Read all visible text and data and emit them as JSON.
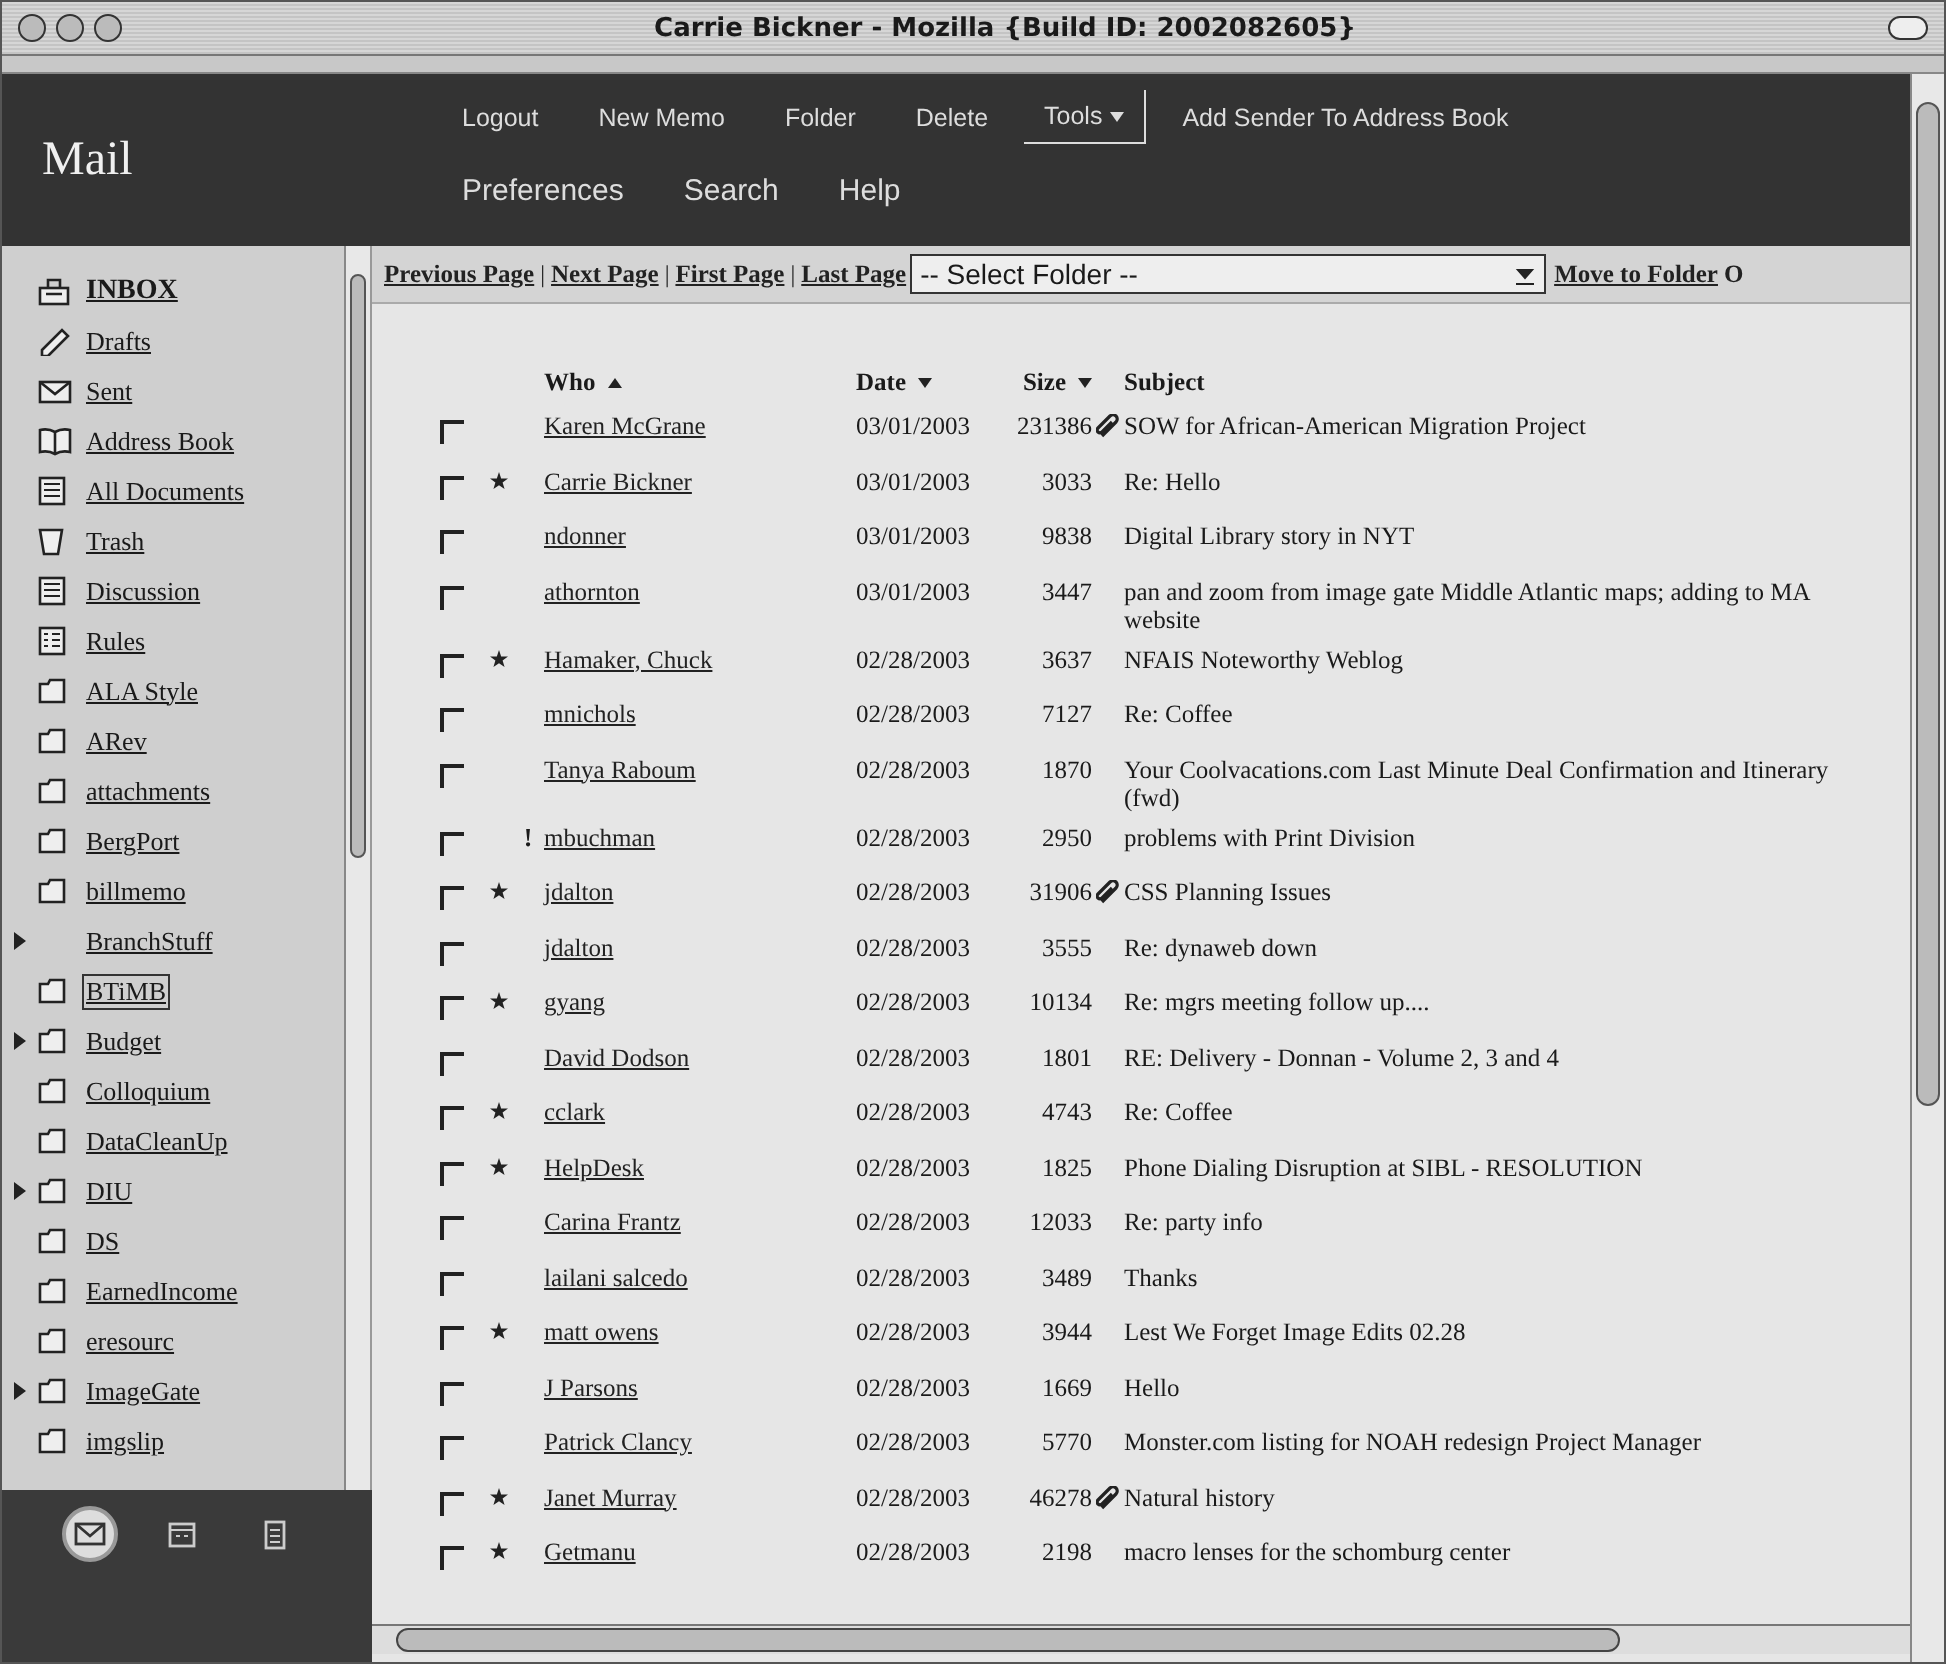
{
  "window": {
    "title": "Carrie Bickner - Mozilla {Build ID: 2002082605}"
  },
  "header": {
    "app_name": "Mail",
    "nav_rows": [
      [
        {
          "label": "Logout",
          "kind": "link"
        },
        {
          "label": "New Memo",
          "kind": "link"
        },
        {
          "label": "Folder",
          "kind": "link"
        },
        {
          "label": "Delete",
          "kind": "link"
        },
        {
          "label": "Tools",
          "kind": "menu"
        },
        {
          "label": "Add Sender To Address Book",
          "kind": "link"
        }
      ],
      [
        {
          "label": "Preferences",
          "kind": "link"
        },
        {
          "label": "Search",
          "kind": "link"
        },
        {
          "label": "Help",
          "kind": "link"
        }
      ]
    ]
  },
  "sidebar": {
    "items": [
      {
        "label": "INBOX",
        "kind": "inbox",
        "expandable": false,
        "selected": false
      },
      {
        "label": "Drafts",
        "kind": "drafts",
        "expandable": false,
        "selected": false
      },
      {
        "label": "Sent",
        "kind": "sent",
        "expandable": false,
        "selected": false
      },
      {
        "label": "Address Book",
        "kind": "book",
        "expandable": false,
        "selected": false
      },
      {
        "label": "All Documents",
        "kind": "document",
        "expandable": false,
        "selected": false
      },
      {
        "label": "Trash",
        "kind": "trash",
        "expandable": false,
        "selected": false
      },
      {
        "label": "Discussion",
        "kind": "document",
        "expandable": false,
        "selected": false
      },
      {
        "label": "Rules",
        "kind": "list",
        "expandable": false,
        "selected": false
      },
      {
        "label": "ALA Style",
        "kind": "folder",
        "expandable": false,
        "selected": false
      },
      {
        "label": "ARev",
        "kind": "folder",
        "expandable": false,
        "selected": false
      },
      {
        "label": "attachments",
        "kind": "folder",
        "expandable": false,
        "selected": false
      },
      {
        "label": "BergPort",
        "kind": "folder",
        "expandable": false,
        "selected": false
      },
      {
        "label": "billmemo",
        "kind": "folder",
        "expandable": false,
        "selected": false
      },
      {
        "label": "BranchStuff",
        "kind": "plain",
        "expandable": true,
        "selected": false
      },
      {
        "label": "BTiMB",
        "kind": "folder",
        "expandable": false,
        "selected": true
      },
      {
        "label": "Budget",
        "kind": "folder",
        "expandable": true,
        "selected": false
      },
      {
        "label": "Colloquium",
        "kind": "folder",
        "expandable": false,
        "selected": false
      },
      {
        "label": "DataCleanUp",
        "kind": "folder",
        "expandable": false,
        "selected": false
      },
      {
        "label": "DIU",
        "kind": "folder",
        "expandable": true,
        "selected": false
      },
      {
        "label": "DS",
        "kind": "folder",
        "expandable": false,
        "selected": false
      },
      {
        "label": "EarnedIncome",
        "kind": "folder",
        "expandable": false,
        "selected": false
      },
      {
        "label": "eresourc",
        "kind": "folder",
        "expandable": false,
        "selected": false
      },
      {
        "label": "ImageGate",
        "kind": "folder",
        "expandable": true,
        "selected": false
      },
      {
        "label": "imgslip",
        "kind": "folder",
        "expandable": false,
        "selected": false
      }
    ],
    "dock": [
      {
        "kind": "mail",
        "selected": true
      },
      {
        "kind": "calendar",
        "selected": false
      },
      {
        "kind": "tasks",
        "selected": false
      }
    ]
  },
  "toolbar": {
    "pager": [
      "Previous Page",
      "Next Page",
      "First Page",
      "Last Page"
    ],
    "separator": "|",
    "folder_select": "-- Select Folder --",
    "move_link": "Move to Folder",
    "cut_link": "O"
  },
  "table": {
    "columns": [
      {
        "label": "Who",
        "sorted": true,
        "descending": false
      },
      {
        "label": "Date",
        "sorted": true,
        "descending": true
      },
      {
        "label": "Size",
        "sorted": true,
        "descending": true
      },
      {
        "label": "Subject",
        "sorted": false
      }
    ],
    "rows": [
      {
        "checked": false,
        "starred": false,
        "who": "Karen McGrane",
        "date": "03/01/2003",
        "size": "231386",
        "attachment": true,
        "subject": "SOW for African-American Migration Project"
      },
      {
        "checked": false,
        "starred": true,
        "who": "Carrie Bickner",
        "date": "03/01/2003",
        "size": "3033",
        "attachment": false,
        "subject": "Re: Hello"
      },
      {
        "checked": false,
        "starred": false,
        "who": "ndonner",
        "date": "03/01/2003",
        "size": "9838",
        "attachment": false,
        "subject": "Digital Library story in NYT"
      },
      {
        "checked": false,
        "starred": false,
        "who": "athornton",
        "date": "03/01/2003",
        "size": "3447",
        "attachment": false,
        "subject": "pan and zoom from image gate Middle Atlantic maps; adding to MA website"
      },
      {
        "checked": false,
        "starred": true,
        "who": "Hamaker, Chuck",
        "date": "02/28/2003",
        "size": "3637",
        "attachment": false,
        "subject": "NFAIS Noteworthy Weblog"
      },
      {
        "checked": false,
        "starred": false,
        "who": "mnichols",
        "date": "02/28/2003",
        "size": "7127",
        "attachment": false,
        "subject": "Re: Coffee"
      },
      {
        "checked": false,
        "starred": false,
        "who": "Tanya Raboum",
        "date": "02/28/2003",
        "size": "1870",
        "attachment": false,
        "subject": "Your Coolvacations.com Last Minute Deal Confirmation and Itinerary (fwd)"
      },
      {
        "checked": false,
        "starred": false,
        "priority": "!",
        "who": "mbuchman",
        "date": "02/28/2003",
        "size": "2950",
        "attachment": false,
        "subject": "problems with Print Division"
      },
      {
        "checked": false,
        "starred": true,
        "who": "jdalton",
        "date": "02/28/2003",
        "size": "31906",
        "attachment": true,
        "subject": "CSS Planning Issues"
      },
      {
        "checked": false,
        "starred": false,
        "who": "jdalton",
        "date": "02/28/2003",
        "size": "3555",
        "attachment": false,
        "subject": "Re: dynaweb down"
      },
      {
        "checked": false,
        "starred": true,
        "who": "gyang",
        "date": "02/28/2003",
        "size": "10134",
        "attachment": false,
        "subject": "Re: mgrs meeting follow up...."
      },
      {
        "checked": false,
        "starred": false,
        "who": "David Dodson",
        "date": "02/28/2003",
        "size": "1801",
        "attachment": false,
        "subject": "RE: Delivery - Donnan - Volume 2, 3 and 4"
      },
      {
        "checked": false,
        "starred": true,
        "who": "cclark",
        "date": "02/28/2003",
        "size": "4743",
        "attachment": false,
        "subject": "Re: Coffee"
      },
      {
        "checked": false,
        "starred": true,
        "who": "HelpDesk",
        "date": "02/28/2003",
        "size": "1825",
        "attachment": false,
        "subject": "Phone Dialing Disruption at SIBL - RESOLUTION"
      },
      {
        "checked": false,
        "starred": false,
        "who": "Carina Frantz",
        "date": "02/28/2003",
        "size": "12033",
        "attachment": false,
        "subject": "Re: party info"
      },
      {
        "checked": false,
        "starred": false,
        "who": "lailani salcedo",
        "date": "02/28/2003",
        "size": "3489",
        "attachment": false,
        "subject": "Thanks"
      },
      {
        "checked": false,
        "starred": true,
        "who": "matt owens",
        "date": "02/28/2003",
        "size": "3944",
        "attachment": false,
        "subject": "Lest We Forget Image Edits 02.28"
      },
      {
        "checked": false,
        "starred": false,
        "who": "J Parsons",
        "date": "02/28/2003",
        "size": "1669",
        "attachment": false,
        "subject": "Hello"
      },
      {
        "checked": false,
        "starred": false,
        "who": "Patrick Clancy",
        "date": "02/28/2003",
        "size": "5770",
        "attachment": false,
        "subject": "Monster.com listing for NOAH redesign Project Manager"
      },
      {
        "checked": false,
        "starred": true,
        "who": "Janet Murray",
        "date": "02/28/2003",
        "size": "46278",
        "attachment": true,
        "subject": "Natural history"
      },
      {
        "checked": false,
        "starred": true,
        "who": "Getmanu",
        "date": "02/28/2003",
        "size": "2198",
        "attachment": false,
        "subject": "macro lenses for the schomburg center"
      }
    ]
  }
}
